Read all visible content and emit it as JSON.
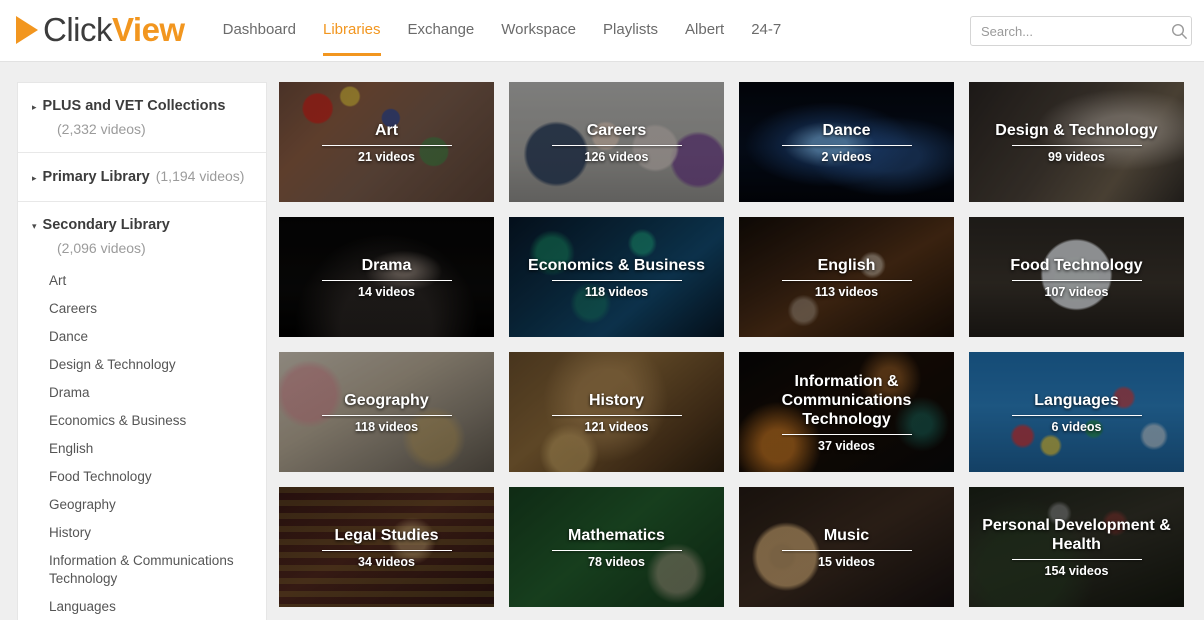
{
  "header": {
    "logo": {
      "part1": "Click",
      "part2": "View",
      "icon": "play-triangle-icon"
    },
    "nav": [
      {
        "label": "Dashboard",
        "active": false
      },
      {
        "label": "Libraries",
        "active": true
      },
      {
        "label": "Exchange",
        "active": false
      },
      {
        "label": "Workspace",
        "active": false
      },
      {
        "label": "Playlists",
        "active": false
      },
      {
        "label": "Albert",
        "active": false
      },
      {
        "label": "24-7",
        "active": false
      }
    ],
    "search": {
      "placeholder": "Search...",
      "value": "",
      "icon": "search-icon"
    }
  },
  "sidebar": {
    "groups": [
      {
        "title": "PLUS and VET Collections",
        "count": "(2,332 videos)",
        "count_inline": false,
        "expanded": false,
        "caret": "▸",
        "items": []
      },
      {
        "title": "Primary Library",
        "count": "(1,194 videos)",
        "count_inline": true,
        "expanded": false,
        "caret": "▸",
        "items": []
      },
      {
        "title": "Secondary Library",
        "count": "(2,096 videos)",
        "count_inline": false,
        "expanded": true,
        "caret": "▾",
        "items": [
          "Art",
          "Careers",
          "Dance",
          "Design & Technology",
          "Drama",
          "Economics & Business",
          "English",
          "Food Technology",
          "Geography",
          "History",
          "Information & Communications Technology",
          "Languages"
        ]
      }
    ]
  },
  "grid": {
    "tiles": [
      {
        "title": "Art",
        "count": "21 videos",
        "bg": "bg-art"
      },
      {
        "title": "Careers",
        "count": "126 videos",
        "bg": "bg-careers"
      },
      {
        "title": "Dance",
        "count": "2 videos",
        "bg": "bg-dance"
      },
      {
        "title": "Design & Technology",
        "count": "99 videos",
        "bg": "bg-design"
      },
      {
        "title": "Drama",
        "count": "14 videos",
        "bg": "bg-drama"
      },
      {
        "title": "Economics & Business",
        "count": "118 videos",
        "bg": "bg-economics"
      },
      {
        "title": "English",
        "count": "113 videos",
        "bg": "bg-english"
      },
      {
        "title": "Food Technology",
        "count": "107 videos",
        "bg": "bg-food"
      },
      {
        "title": "Geography",
        "count": "118 videos",
        "bg": "bg-geography"
      },
      {
        "title": "History",
        "count": "121 videos",
        "bg": "bg-history"
      },
      {
        "title": "Information & Communications Technology",
        "count": "37 videos",
        "bg": "bg-ict"
      },
      {
        "title": "Languages",
        "count": "6 videos",
        "bg": "bg-languages"
      },
      {
        "title": "Legal Studies",
        "count": "34 videos",
        "bg": "bg-legal"
      },
      {
        "title": "Mathematics",
        "count": "78 videos",
        "bg": "bg-math"
      },
      {
        "title": "Music",
        "count": "15 videos",
        "bg": "bg-music"
      },
      {
        "title": "Personal Development & Health",
        "count": "154 videos",
        "bg": "bg-pdh"
      }
    ]
  },
  "colors": {
    "brand_orange": "#f2961f",
    "page_background": "#efefef",
    "panel_white": "#ffffff",
    "nav_text": "#6b6b6b",
    "heading_text": "#3c3c3c",
    "muted_text": "#9b9b9b"
  }
}
